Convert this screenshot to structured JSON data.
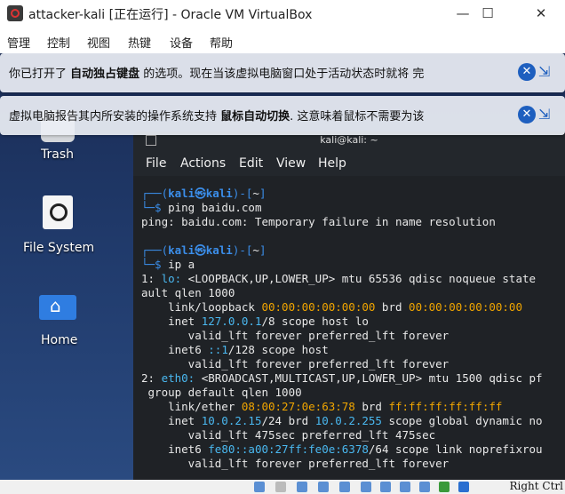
{
  "window": {
    "title": "attacker-kali [正在运行] - Oracle VM VirtualBox",
    "minimize": "—",
    "maximize": "☐",
    "close": "✕"
  },
  "menubar": [
    "管理",
    "控制",
    "视图",
    "热键",
    "设备",
    "帮助"
  ],
  "notifications": [
    {
      "prefix": "你已打开了 ",
      "bold": "自动独占键盘",
      "suffix": " 的选项。现在当该虚拟电脑窗口处于活动状态时就将 完"
    },
    {
      "prefix": "虚拟电脑报告其内所安装的操作系统支持 ",
      "bold": "鼠标自动切换",
      "suffix": ". 这意味着鼠标不需要为该"
    }
  ],
  "desktop": {
    "icons": [
      {
        "label": "Trash",
        "icon": "trash-icon"
      },
      {
        "label": "File System",
        "icon": "drive-icon"
      },
      {
        "label": "Home",
        "icon": "home-folder-icon"
      }
    ]
  },
  "terminal": {
    "title": "kali@kali: ~",
    "menu": [
      "File",
      "Actions",
      "Edit",
      "View",
      "Help"
    ],
    "prompt_user": "kali",
    "prompt_at": "㉿",
    "prompt_host": "kali",
    "prompt_dir": "~",
    "commands": [
      "ping baidu.com",
      "ip a"
    ],
    "lines": {
      "ping_out": "ping: baidu.com: Temporary failure in name resolution",
      "l1a": "1: ",
      "l1b": "lo:",
      "l1c": " <LOOPBACK,UP,LOWER_UP> mtu 65536 qdisc noqueue state",
      "l2": "ault qlen 1000",
      "l3a": "    link/loopback ",
      "l3b": "00:00:00:00:00:00",
      "l3c": " brd ",
      "l3d": "00:00:00:00:00:00",
      "l4a": "    inet ",
      "l4b": "127.0.0.1",
      "l4c": "/8 scope host lo",
      "l5": "       valid_lft forever preferred_lft forever",
      "l6a": "    inet6 ",
      "l6b": "::1",
      "l6c": "/128 scope host",
      "l7": "       valid_lft forever preferred_lft forever",
      "l8a": "2: ",
      "l8b": "eth0:",
      "l8c": " <BROADCAST,MULTICAST,UP,LOWER_UP> mtu 1500 qdisc pf",
      "l9": " group default qlen 1000",
      "l10a": "    link/ether ",
      "l10b": "08:00:27:0e:63:78",
      "l10c": " brd ",
      "l10d": "ff:ff:ff:ff:ff:ff",
      "l11a": "    inet ",
      "l11b": "10.0.2.15",
      "l11c": "/24 brd ",
      "l11d": "10.0.2.255",
      "l11e": " scope global dynamic no",
      "l12": "       valid_lft 475sec preferred_lft 475sec",
      "l13a": "    inet6 ",
      "l13b": "fe80::a00:27ff:fe0e:6378",
      "l13c": "/64 scope link noprefixrou",
      "l14": "       valid_lft forever preferred_lft forever"
    }
  },
  "statusbar": {
    "host_key": "Right Ctrl"
  }
}
